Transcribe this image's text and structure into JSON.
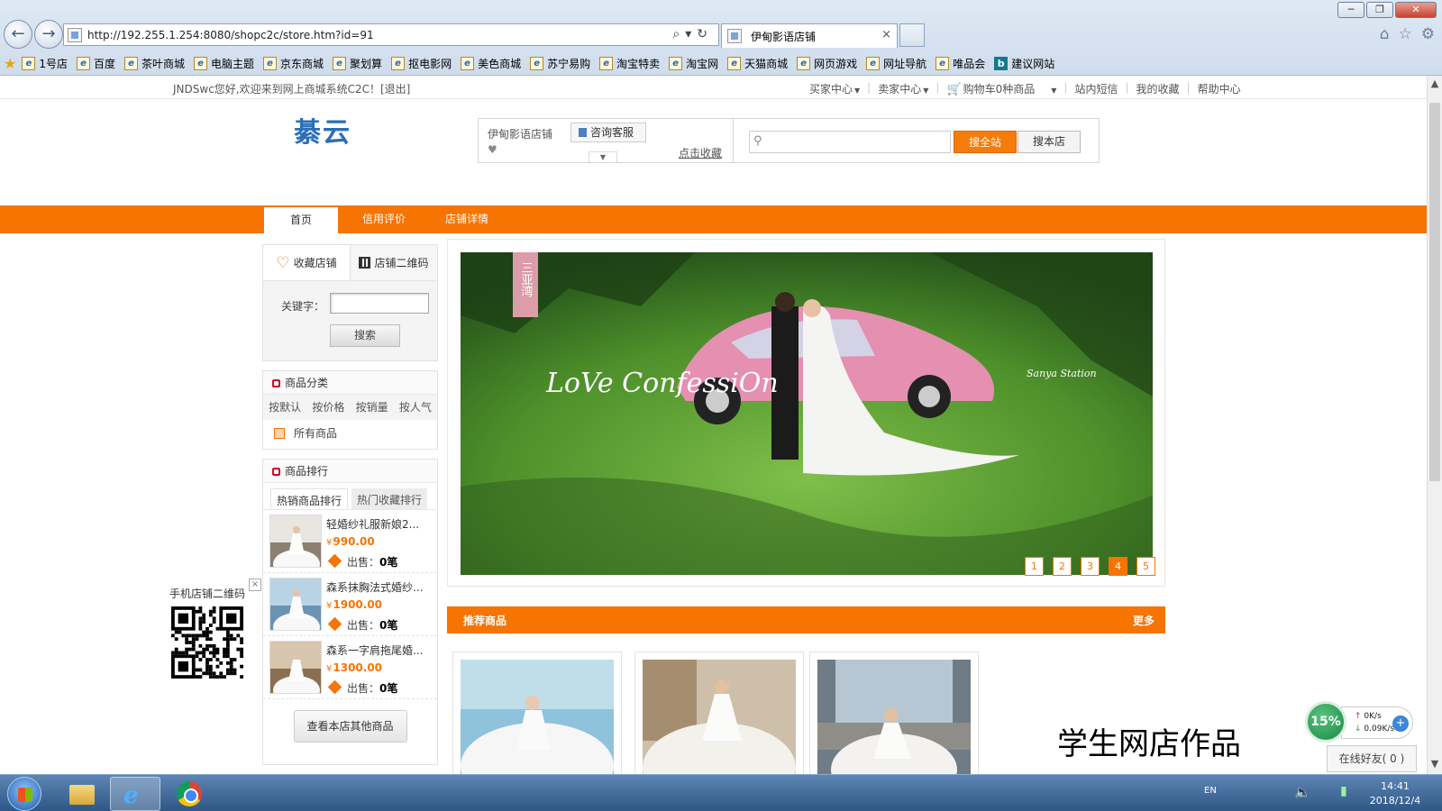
{
  "browser": {
    "url": "http://192.255.1.254:8080/shopc2c/store.htm?id=91",
    "tab_title": "伊甸影语店铺",
    "tab_close": "×",
    "window_buttons": [
      "─",
      "❐",
      "✕"
    ],
    "back": "←",
    "forward": "→",
    "addr_tools": "⌕▾↻",
    "right_icons": [
      "⌂",
      "☆",
      "⚙"
    ]
  },
  "favorites": [
    {
      "label": "1号店",
      "icon": "ie-page-icon"
    },
    {
      "label": "百度",
      "icon": "ie-page-icon"
    },
    {
      "label": "茶叶商城",
      "icon": "ie-page-icon"
    },
    {
      "label": "电脑主题",
      "icon": "ie-page-icon"
    },
    {
      "label": "京东商城",
      "icon": "ie-page-icon"
    },
    {
      "label": "聚划算",
      "icon": "ie-page-icon"
    },
    {
      "label": "抠电影网",
      "icon": "ie-page-icon"
    },
    {
      "label": "美色商城",
      "icon": "ie-page-icon"
    },
    {
      "label": "苏宁易购",
      "icon": "ie-page-icon"
    },
    {
      "label": "淘宝特卖",
      "icon": "ie-page-icon"
    },
    {
      "label": "淘宝网",
      "icon": "ie-page-icon"
    },
    {
      "label": "天猫商城",
      "icon": "ie-page-icon"
    },
    {
      "label": "网页游戏",
      "icon": "ie-page-icon"
    },
    {
      "label": "网址导航",
      "icon": "ie-page-icon"
    },
    {
      "label": "唯品会",
      "icon": "ie-page-icon"
    },
    {
      "label": "建议网站",
      "icon": "bing-icon"
    }
  ],
  "topbar": {
    "welcome": "JNDSwc您好,欢迎来到网上商城系统C2C！[退出]",
    "buyer": "买家中心",
    "seller": "卖家中心",
    "cart": "购物车0种商品",
    "sms": "站内短信",
    "favorites": "我的收藏",
    "help": "帮助中心"
  },
  "header": {
    "logo": "綦云",
    "store_name": "伊甸影语店铺",
    "consult": "咨询客服",
    "favorite_link": "点击收藏",
    "search_placeholder": "",
    "search_all": "搜全站",
    "search_shop": "搜本店"
  },
  "nav": [
    "首页",
    "信用评价",
    "店铺详情"
  ],
  "sidebar": {
    "fav_store": "收藏店铺",
    "store_qr": "店铺二维码",
    "keyword_label": "关键字：",
    "search_btn": "搜索",
    "category_title": "商品分类",
    "sort_options": [
      "按默认",
      "按价格",
      "按销量",
      "按人气"
    ],
    "all_goods": "所有商品",
    "ranking_title": "商品排行",
    "rank_tabs": [
      "热销商品排行",
      "热门收藏排行"
    ],
    "rank_items": [
      {
        "name": "轻婚纱礼服新娘2...",
        "price": "990.00",
        "sold_label": "出售：",
        "sold": "0笔"
      },
      {
        "name": "森系抹胸法式婚纱...",
        "price": "1900.00",
        "sold_label": "出售：",
        "sold": "0笔"
      },
      {
        "name": "森系一字肩拖尾婚...",
        "price": "1300.00",
        "sold_label": "出售：",
        "sold": "0笔"
      }
    ],
    "currency": "¥",
    "more_goods": "查看本店其他商品"
  },
  "float_qr": {
    "label": "手机店铺二维码",
    "close": "×"
  },
  "banner": {
    "badge": "三亚湾",
    "script_text": "LoVe ConfessiOn",
    "caption": "Sanya Station",
    "pages": [
      "1",
      "2",
      "3",
      "4",
      "5"
    ],
    "active_page": 4
  },
  "recommend": {
    "title": "推荐商品",
    "more": "更多"
  },
  "watermark": "学生网店作品",
  "speed_widget": {
    "percent": "15%",
    "up": "0K/s",
    "down": "0.09K/s",
    "plus": "+"
  },
  "online_friends": "在线好友( 0 )",
  "taskbar": {
    "lang": "EN",
    "time": "14:41",
    "date": "2018/12/4"
  },
  "colors": {
    "accent": "#f57402",
    "link_blue": "#2b6fb7"
  }
}
